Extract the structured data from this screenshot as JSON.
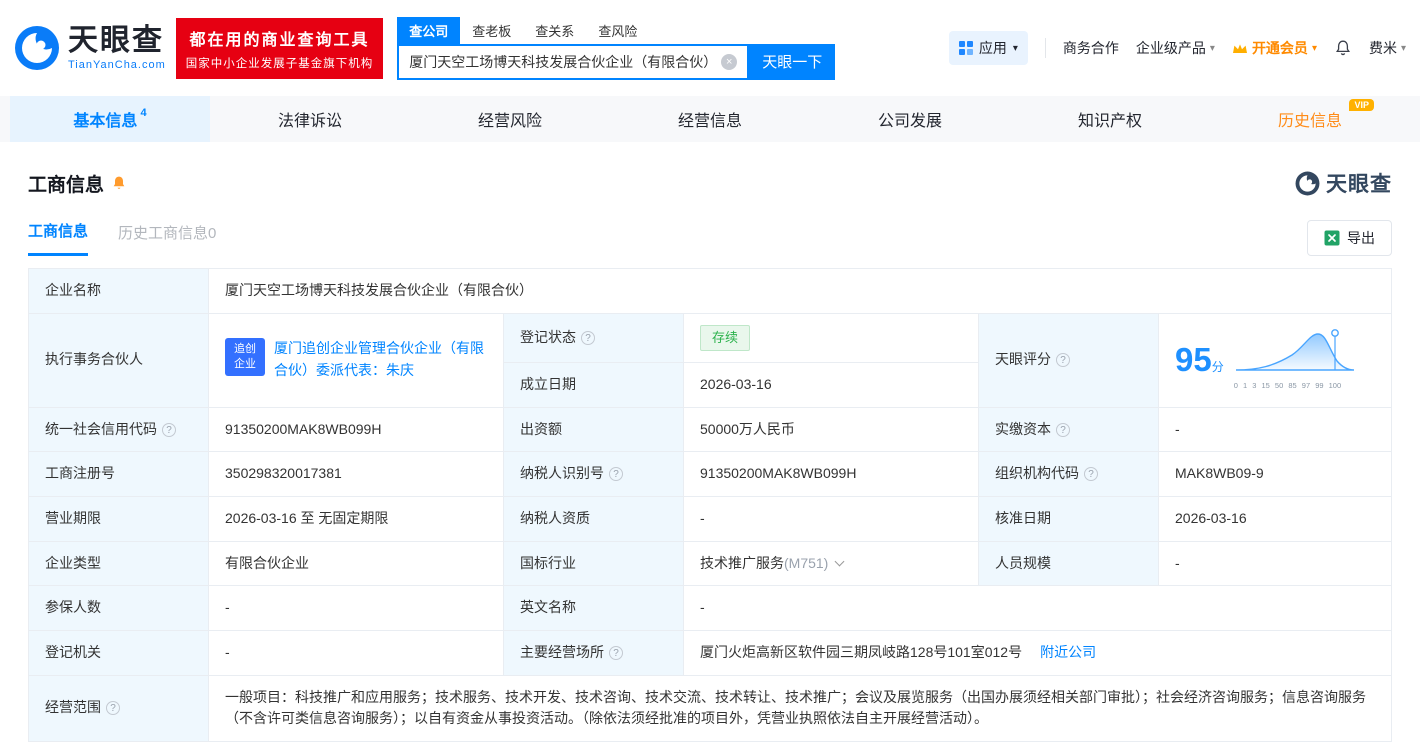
{
  "brand": {
    "logo_cn": "天眼查",
    "logo_en": "TianYanCha.com",
    "banner_line1": "都在用的商业查询工具",
    "banner_line2": "国家中小企业发展子基金旗下机构",
    "watermark": "天眼查"
  },
  "icons": {
    "caret_down": "▾",
    "clear": "×",
    "question": "?"
  },
  "search": {
    "tabs": [
      {
        "label": "查公司"
      },
      {
        "label": "查老板"
      },
      {
        "label": "查关系"
      },
      {
        "label": "查风险"
      }
    ],
    "value": "厦门天空工场博天科技发展合伙企业（有限合伙）",
    "button": "天眼一下"
  },
  "topnav": {
    "apps": "应用",
    "cooperation": "商务合作",
    "enterprise_products": "企业级产品",
    "vip": "开通会员",
    "user": "费米"
  },
  "main_tabs": [
    {
      "label": "基本信息",
      "count": "4"
    },
    {
      "label": "法律诉讼"
    },
    {
      "label": "经营风险"
    },
    {
      "label": "经营信息"
    },
    {
      "label": "公司发展"
    },
    {
      "label": "知识产权"
    },
    {
      "label": "历史信息",
      "badge": "VIP"
    }
  ],
  "section": {
    "title": "工商信息",
    "sub_tab_active": "工商信息",
    "sub_tab_history": "历史工商信息0",
    "export": "导出"
  },
  "fields": {
    "company_name": {
      "label": "企业名称",
      "value": "厦门天空工场博天科技发展合伙企业（有限合伙）"
    },
    "managing_partner": {
      "label": "执行事务合伙人",
      "badge_line1": "追创",
      "badge_line2": "企业",
      "link": "厦门追创企业管理合伙企业（有限合伙）委派代表：朱庆"
    },
    "reg_status": {
      "label": "登记状态",
      "value": "存续"
    },
    "established": {
      "label": "成立日期",
      "value": "2026-03-16"
    },
    "score": {
      "label": "天眼评分",
      "value": "95",
      "unit": "分",
      "axis": "0 1 3 15 50 85 97 99 100"
    },
    "credit_code": {
      "label": "统一社会信用代码",
      "value": "91350200MAK8WB099H"
    },
    "capital": {
      "label": "出资额",
      "value": "50000万人民币"
    },
    "paid_capital": {
      "label": "实缴资本",
      "value": "-"
    },
    "reg_number": {
      "label": "工商注册号",
      "value": "350298320017381"
    },
    "taxpayer_id": {
      "label": "纳税人识别号",
      "value": "91350200MAK8WB099H"
    },
    "org_code": {
      "label": "组织机构代码",
      "value": "MAK8WB09-9"
    },
    "business_term": {
      "label": "营业期限",
      "value": "2026-03-16 至 无固定期限"
    },
    "taxpayer_qualification": {
      "label": "纳税人资质",
      "value": "-"
    },
    "approval_date": {
      "label": "核准日期",
      "value": "2026-03-16"
    },
    "company_type": {
      "label": "企业类型",
      "value": "有限合伙企业"
    },
    "industry": {
      "label": "国标行业",
      "value": "技术推广服务",
      "code": "(M751)"
    },
    "staff_size": {
      "label": "人员规模",
      "value": "-"
    },
    "insured_count": {
      "label": "参保人数",
      "value": "-"
    },
    "english_name": {
      "label": "英文名称",
      "value": "-"
    },
    "reg_authority": {
      "label": "登记机关",
      "value": "-"
    },
    "address": {
      "label": "主要经营场所",
      "value": "厦门火炬高新区软件园三期凤岐路128号101室012号",
      "link": "附近公司"
    },
    "business_scope": {
      "label": "经营范围",
      "value": "一般项目：科技推广和应用服务；技术服务、技术开发、技术咨询、技术交流、技术转让、技术推广；会议及展览服务（出国办展须经相关部门审批）；社会经济咨询服务；信息咨询服务（不含许可类信息咨询服务）；以自有资金从事投资活动。（除依法须经批准的项目外，凭营业执照依法自主开展经营活动）。"
    }
  },
  "colors": {
    "brand_blue": "#0084ff",
    "banner_red": "#e60012",
    "vip_orange": "#ff8a00",
    "status_green": "#2bb24c"
  }
}
